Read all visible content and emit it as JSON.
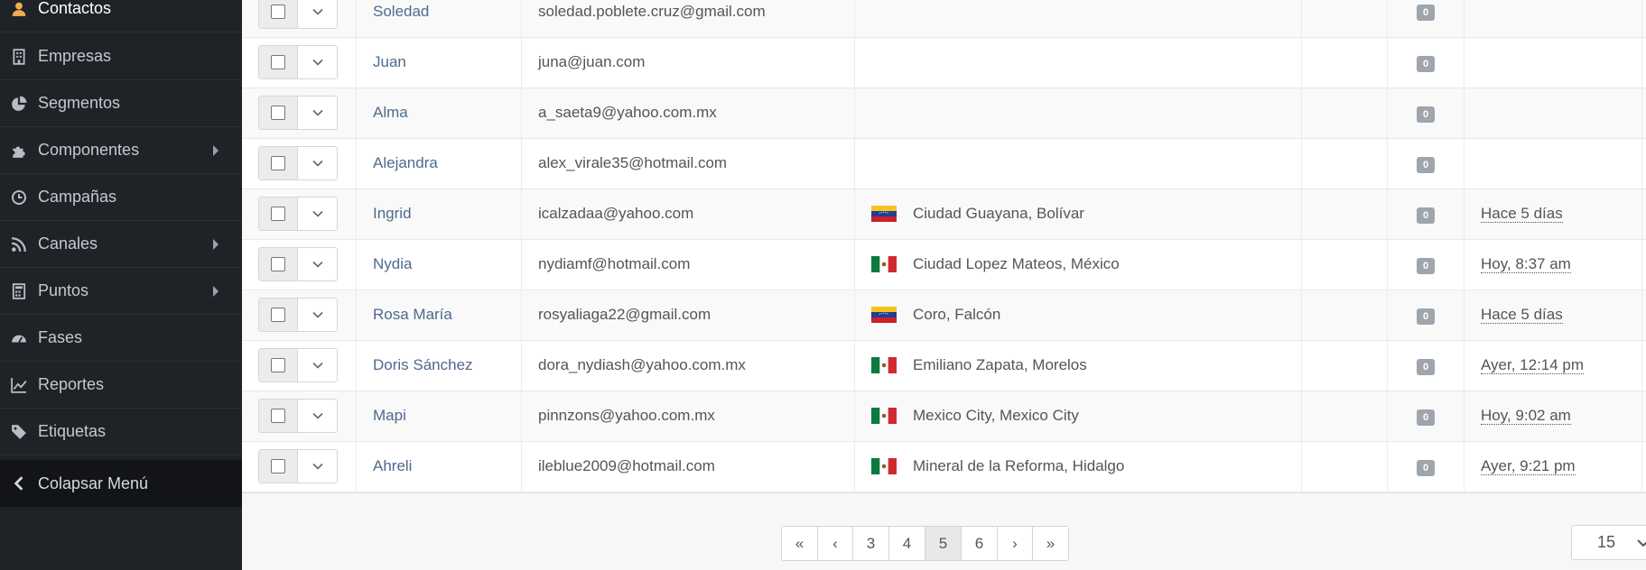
{
  "sidebar": {
    "items": [
      {
        "label": "Contactos",
        "icon": "user-icon",
        "submenu": false
      },
      {
        "label": "Empresas",
        "icon": "building-icon",
        "submenu": false
      },
      {
        "label": "Segmentos",
        "icon": "pie-chart-icon",
        "submenu": false
      },
      {
        "label": "Componentes",
        "icon": "puzzle-icon",
        "submenu": true
      },
      {
        "label": "Campañas",
        "icon": "clock-icon",
        "submenu": false
      },
      {
        "label": "Canales",
        "icon": "rss-icon",
        "submenu": true
      },
      {
        "label": "Puntos",
        "icon": "calculator-icon",
        "submenu": true
      },
      {
        "label": "Fases",
        "icon": "dashboard-icon",
        "submenu": false
      },
      {
        "label": "Reportes",
        "icon": "line-chart-icon",
        "submenu": false
      },
      {
        "label": "Etiquetas",
        "icon": "tag-icon",
        "submenu": false
      },
      {
        "label": "Colapsar Menú",
        "icon": "chevron-left-icon",
        "submenu": false
      }
    ],
    "active_color": "#f0ad4e"
  },
  "table": {
    "rows": [
      {
        "name": "Soledad",
        "email": "soledad.poblete.cruz@gmail.com",
        "location": "",
        "flag": "",
        "points": "0",
        "last_active": "",
        "id": "74"
      },
      {
        "name": "Juan",
        "email": "juna@juan.com",
        "location": "",
        "flag": "",
        "points": "0",
        "last_active": "",
        "id": "75"
      },
      {
        "name": "Alma",
        "email": "a_saeta9@yahoo.com.mx",
        "location": "",
        "flag": "",
        "points": "0",
        "last_active": "",
        "id": "76"
      },
      {
        "name": "Alejandra",
        "email": "alex_virale35@hotmail.com",
        "location": "",
        "flag": "",
        "points": "0",
        "last_active": "",
        "id": "77"
      },
      {
        "name": "Ingrid",
        "email": "icalzadaa@yahoo.com",
        "location": "Ciudad Guayana, Bolívar",
        "flag": "venezuela-flag-icon",
        "points": "0",
        "last_active": "Hace 5 días",
        "id": "325"
      },
      {
        "name": "Nydia",
        "email": "nydiamf@hotmail.com",
        "location": "Ciudad Lopez Mateos, México",
        "flag": "mexico-flag-icon",
        "points": "0",
        "last_active": "Hoy, 8:37 am",
        "id": "338"
      },
      {
        "name": "Rosa María",
        "email": "rosyaliaga22@gmail.com",
        "location": "Coro, Falcón",
        "flag": "venezuela-flag-icon",
        "points": "0",
        "last_active": "Hace 5 días",
        "id": "324"
      },
      {
        "name": "Doris Sánchez",
        "email": "dora_nydiash@yahoo.com.mx",
        "location": "Emiliano Zapata, Morelos",
        "flag": "mexico-flag-icon",
        "points": "0",
        "last_active": "Ayer, 12:14 pm",
        "id": "334"
      },
      {
        "name": "Mapi",
        "email": "pinnzons@yahoo.com.mx",
        "location": "Mexico City, Mexico City",
        "flag": "mexico-flag-icon",
        "points": "0",
        "last_active": "Hoy, 9:02 am",
        "id": "339"
      },
      {
        "name": "Ahreli",
        "email": "ileblue2009@hotmail.com",
        "location": "Mineral de la Reforma, Hidalgo",
        "flag": "mexico-flag-icon",
        "points": "0",
        "last_active": "Ayer, 9:21 pm",
        "id": "335"
      }
    ]
  },
  "pagination": {
    "first": "«",
    "prev": "‹",
    "pages": [
      "3",
      "4",
      "5",
      "6"
    ],
    "current": "5",
    "next": "›",
    "last": "»"
  },
  "per_page": {
    "selected": "15"
  }
}
